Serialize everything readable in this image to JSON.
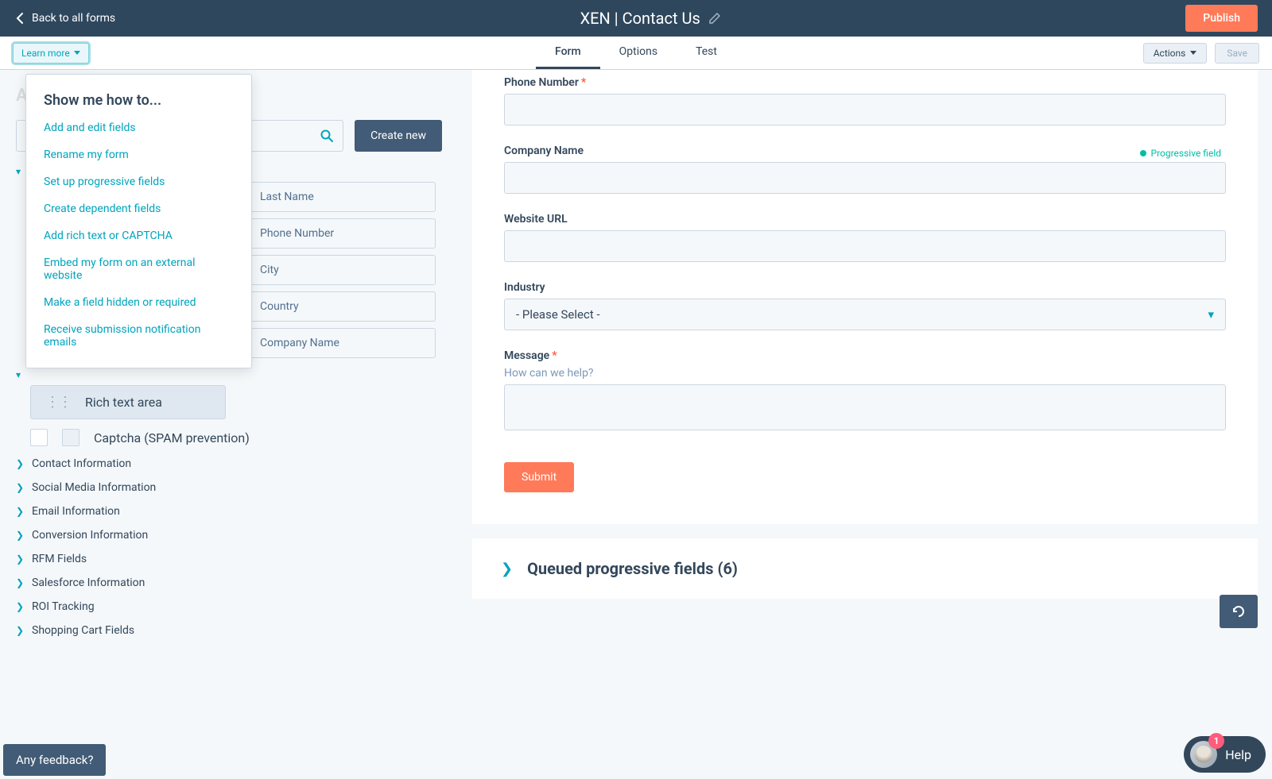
{
  "header": {
    "back_label": "Back to all forms",
    "title": "XEN | Contact Us",
    "publish_label": "Publish"
  },
  "toolbar": {
    "learn_more_label": "Learn more",
    "tabs": [
      "Form",
      "Options",
      "Test"
    ],
    "actions_label": "Actions",
    "save_label": "Save"
  },
  "learn_dropdown": {
    "heading": "Show me how to...",
    "links": [
      "Add and edit fields",
      "Rename my form",
      "Set up progressive fields",
      "Create dependent fields",
      "Add rich text or CAPTCHA",
      "Embed my form on an external website",
      "Make a field hidden or required",
      "Receive submission notification emails"
    ]
  },
  "left": {
    "heading": "Add form field",
    "search_placeholder": "Search",
    "create_new_label": "Create new",
    "field_options": [
      "Last Name",
      "Phone Number",
      "City",
      "Country",
      "Company Name"
    ],
    "other_group_label": "Rich text area",
    "captcha_label": "Captcha (SPAM prevention)",
    "groups": [
      "Contact Information",
      "Social Media Information",
      "Email Information",
      "Conversion Information",
      "RFM Fields",
      "Salesforce Information",
      "ROI Tracking",
      "Shopping Cart Fields"
    ]
  },
  "preview": {
    "fields": {
      "phone": {
        "label": "Phone Number",
        "required": true
      },
      "company": {
        "label": "Company Name",
        "progressive_badge": "Progressive field"
      },
      "website": {
        "label": "Website URL"
      },
      "industry": {
        "label": "Industry",
        "placeholder": "- Please Select -"
      },
      "message": {
        "label": "Message",
        "required": true,
        "help": "How can we help?"
      }
    },
    "submit_label": "Submit",
    "queued_label": "Queued progressive fields (6)"
  },
  "footer": {
    "feedback_label": "Any feedback?",
    "help_label": "Help",
    "help_badge": "1"
  }
}
